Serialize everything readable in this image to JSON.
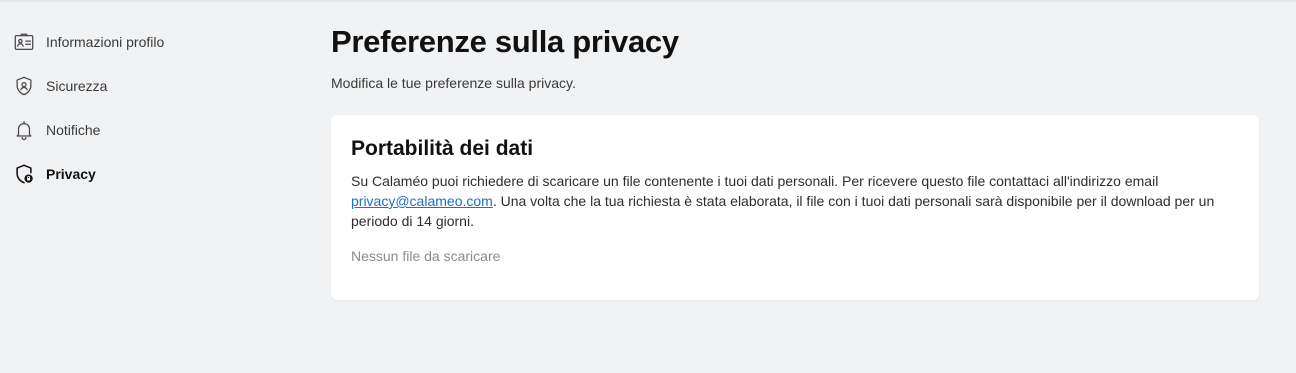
{
  "sidebar": {
    "items": [
      {
        "label": "Informazioni profilo",
        "icon": "id-card-icon",
        "active": false
      },
      {
        "label": "Sicurezza",
        "icon": "shield-icon",
        "active": false
      },
      {
        "label": "Notifiche",
        "icon": "bell-icon",
        "active": false
      },
      {
        "label": "Privacy",
        "icon": "shield-lock-icon",
        "active": true
      }
    ]
  },
  "main": {
    "title": "Preferenze sulla privacy",
    "subtitle": "Modifica le tue preferenze sulla privacy.",
    "card": {
      "title": "Portabilità dei dati",
      "text_before_link": "Su Calaméo puoi richiedere di scaricare un file contenente i tuoi dati personali. Per ricevere questo file contattaci all'indirizzo email ",
      "link_text": "privacy@calameo.com",
      "text_after_link": ". Una volta che la tua richiesta è stata elaborata, il file con i tuoi dati personali sarà disponibile per il download per un periodo di 14 giorni.",
      "empty_state": "Nessun file da scaricare"
    }
  },
  "colors": {
    "background": "#f1f2f4",
    "card": "#ffffff",
    "link": "#1f6fc4",
    "muted": "#888c91"
  }
}
